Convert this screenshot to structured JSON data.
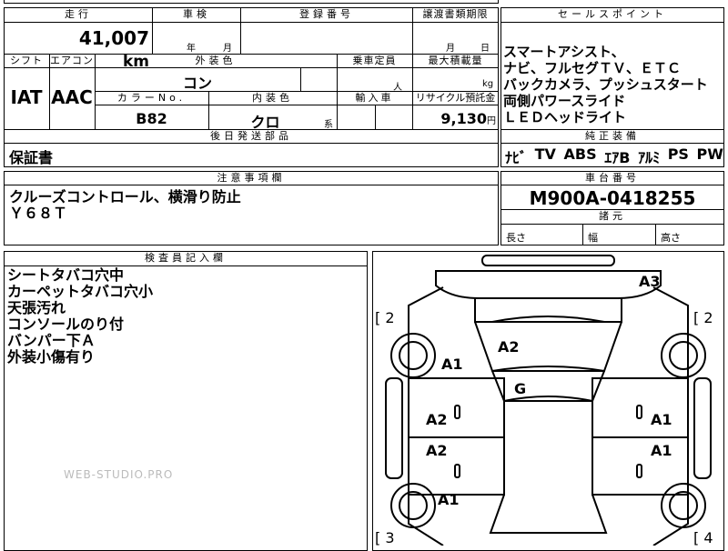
{
  "top": {
    "mileage_label": "走行",
    "mileage_value": "41,007",
    "mileage_unit": "km",
    "inspection_label": "車検",
    "inspection_year": "年",
    "inspection_month": "月",
    "reg_label": "登録番号",
    "transfer_label": "譲渡書類期限",
    "transfer_month": "月",
    "transfer_day": "日"
  },
  "row2": {
    "shift_label": "シフト",
    "shift_value": "IAT",
    "aircon_label": "エアコン",
    "aircon_value": "AAC",
    "exterior_label": "外装色",
    "exterior_value": "コン",
    "capacity_label": "乗車定員",
    "capacity_unit": "人",
    "load_label": "最大積載量",
    "load_unit": "kg",
    "color_no_label": "カラーNo.",
    "color_no_value": "B82",
    "interior_label": "内装色",
    "interior_value": "クロ",
    "interior_suffix": "系",
    "import_label": "輸入車",
    "recycle_label": "リサイクル預託金",
    "recycle_value": "9,130",
    "recycle_unit": "円"
  },
  "later_parts": {
    "label": "後日発送部品",
    "value": "保証書"
  },
  "sales": {
    "label": "セールスポイント",
    "lines": "スマートアシスト、\nナビ、フルセグＴＶ、ＥＴＣ\nバックカメラ、プッシュスタート\n両側パワースライド\nＬＥＤヘッドライト"
  },
  "equipment": {
    "label": "純正装備",
    "items": [
      "ﾅﾋﾞ",
      "TV",
      "ABS",
      "ｴｱB",
      "ｱﾙﾐ",
      "PS",
      "PW"
    ]
  },
  "notes": {
    "label": "注意事項欄",
    "lines": "クルーズコントロール、横滑り防止\nＹ６８Ｔ"
  },
  "chassis": {
    "label": "車台番号",
    "value": "M900A-0418255"
  },
  "dims": {
    "label": "諸元",
    "length": "長さ",
    "width": "幅",
    "height": "高さ"
  },
  "inspector": {
    "label": "検査員記入欄",
    "lines": "シートタバコ穴中\nカーペットタバコ穴小\n天張汚れ\nコンソールのり付\nバンパー下Ａ\n外装小傷有り"
  },
  "watermark": "WEB-STUDIO.PRO",
  "diagram": {
    "marks": [
      "A3",
      "A2",
      "A1",
      "G",
      "A2",
      "A1",
      "A2",
      "A1",
      "A1"
    ],
    "corner_tl": "[ 2",
    "corner_tr": "[ 2",
    "corner_bl": "[ 3",
    "corner_br": "[ 4"
  }
}
